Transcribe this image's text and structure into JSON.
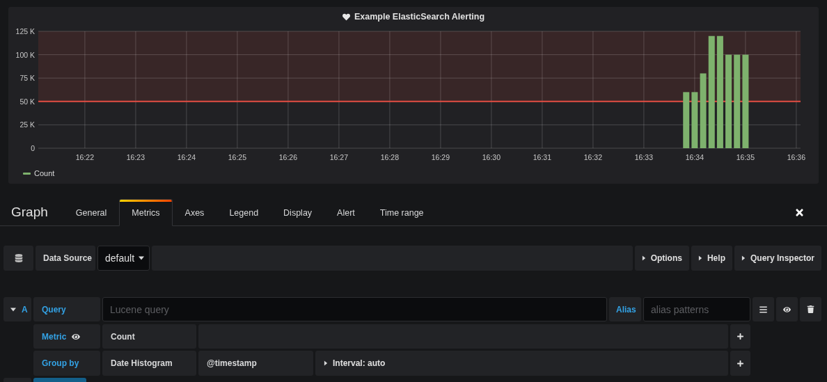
{
  "panel": {
    "title": "Example ElasticSearch Alerting",
    "chart_data": {
      "type": "bar",
      "ylim": [
        0,
        125000
      ],
      "grid": true,
      "categories": [
        null,
        null,
        null,
        null,
        null,
        "16:22",
        null,
        null,
        null,
        null,
        null,
        "16:23",
        null,
        null,
        null,
        null,
        null,
        "16:24",
        null,
        null,
        null,
        null,
        null,
        "16:25",
        null,
        null,
        null,
        null,
        null,
        "16:26",
        null,
        null,
        null,
        null,
        null,
        "16:27",
        null,
        null,
        null,
        null,
        null,
        "16:28",
        null,
        null,
        null,
        null,
        null,
        "16:29",
        null,
        null,
        null,
        null,
        null,
        "16:30",
        null,
        null,
        null,
        null,
        null,
        "16:31",
        null,
        null,
        null,
        null,
        null,
        "16:32",
        null,
        null,
        null,
        null,
        null,
        "16:33",
        null,
        null,
        null,
        null,
        null,
        "16:34",
        null,
        null,
        null,
        null,
        null,
        "16:35",
        null,
        null,
        null,
        null,
        null,
        "16:36"
      ],
      "yticks": [
        {
          "value": 0,
          "label": "0"
        },
        {
          "value": 25000,
          "label": "25 K"
        },
        {
          "value": 50000,
          "label": "50 K"
        },
        {
          "value": 75000,
          "label": "75 K"
        },
        {
          "value": 100000,
          "label": "100 K"
        },
        {
          "value": 125000,
          "label": "125 K"
        }
      ],
      "series": [
        {
          "name": "Count",
          "color": "#7eb26d",
          "values": [
            null,
            null,
            null,
            null,
            null,
            null,
            null,
            null,
            null,
            null,
            null,
            null,
            null,
            null,
            null,
            null,
            null,
            null,
            null,
            null,
            null,
            null,
            null,
            null,
            null,
            null,
            null,
            null,
            null,
            null,
            null,
            null,
            null,
            null,
            null,
            null,
            null,
            null,
            null,
            null,
            null,
            null,
            null,
            null,
            null,
            null,
            null,
            null,
            null,
            null,
            null,
            null,
            null,
            null,
            null,
            null,
            null,
            null,
            null,
            null,
            null,
            null,
            null,
            null,
            null,
            null,
            null,
            null,
            null,
            null,
            null,
            null,
            null,
            null,
            null,
            null,
            60000,
            60000,
            80000,
            120000,
            120000,
            100000,
            100000,
            100000,
            null,
            null,
            null,
            null,
            null,
            null
          ]
        }
      ],
      "ref_lines": [
        {
          "axis": "y",
          "value": 50000,
          "color": "#e24d42"
        }
      ],
      "bands": [
        {
          "axis": "y",
          "from": 50000,
          "to": 125000,
          "color": "#e24d42"
        }
      ]
    }
  },
  "editor": {
    "title": "Graph",
    "tabs": [
      {
        "label": "General",
        "selected": false
      },
      {
        "label": "Metrics",
        "selected": true
      },
      {
        "label": "Axes",
        "selected": false
      },
      {
        "label": "Legend",
        "selected": false
      },
      {
        "label": "Display",
        "selected": false
      },
      {
        "label": "Alert",
        "selected": false
      },
      {
        "label": "Time range",
        "selected": false
      }
    ]
  },
  "datasource": {
    "label": "Data Source",
    "value": "default",
    "buttons": [
      "Options",
      "Help",
      "Query Inspector"
    ]
  },
  "query": {
    "ref": "A",
    "expanded": true,
    "query_label": "Query",
    "query_placeholder": "Lucene query",
    "alias_label": "Alias",
    "alias_placeholder": "alias patterns",
    "metric": {
      "label": "Metric",
      "type": "Count"
    },
    "group_by": {
      "label": "Group by",
      "aggregation": "Date Histogram",
      "field": "@timestamp",
      "interval": "Interval: auto"
    }
  }
}
